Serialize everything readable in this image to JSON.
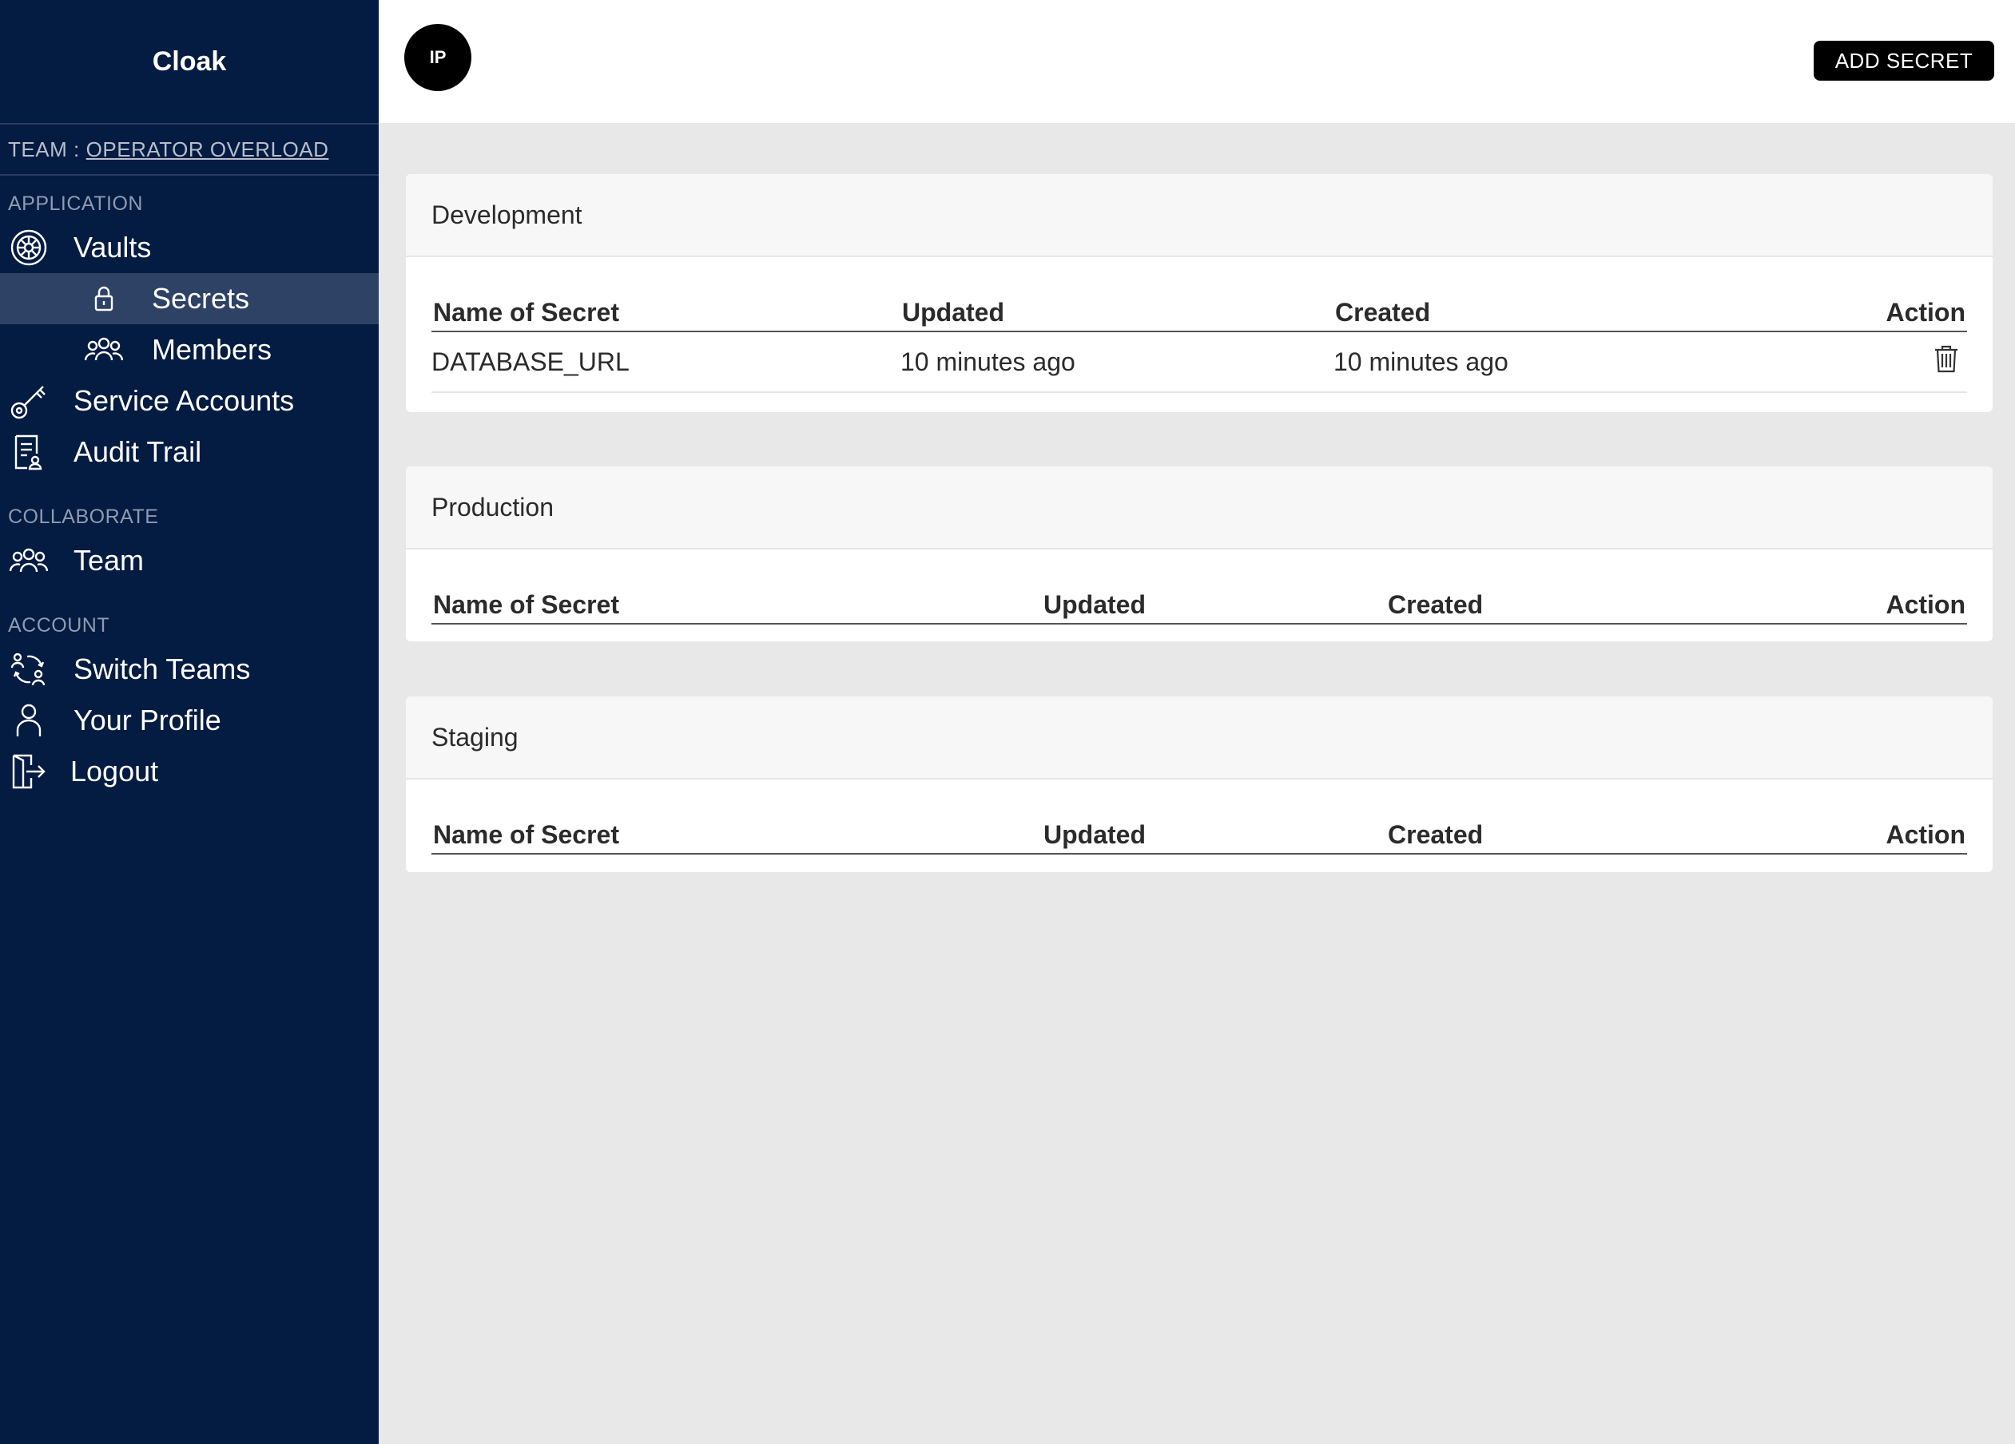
{
  "app": {
    "name": "Cloak"
  },
  "team": {
    "prefix": "TEAM :",
    "name": "OPERATOR OVERLOAD"
  },
  "sidebar": {
    "sections": {
      "application": "APPLICATION",
      "collaborate": "COLLABORATE",
      "account": "ACCOUNT"
    },
    "items": {
      "vaults": "Vaults",
      "secrets": "Secrets",
      "members": "Members",
      "service_accounts": "Service Accounts",
      "audit_trail": "Audit Trail",
      "team": "Team",
      "switch_teams": "Switch Teams",
      "your_profile": "Your Profile",
      "logout": "Logout"
    },
    "active_item": "Secrets"
  },
  "header": {
    "avatar_initials": "IP",
    "add_button": "ADD SECRET"
  },
  "environments": [
    {
      "name": "Development",
      "columns": [
        "Name of Secret",
        "Updated",
        "Created",
        "Action"
      ],
      "rows": [
        {
          "name": "DATABASE_URL",
          "updated": "10 minutes ago",
          "created": "10 minutes ago",
          "action_icon": "trash-icon"
        }
      ]
    },
    {
      "name": "Production",
      "columns": [
        "Name of Secret",
        "Updated",
        "Created",
        "Action"
      ],
      "rows": []
    },
    {
      "name": "Staging",
      "columns": [
        "Name of Secret",
        "Updated",
        "Created",
        "Action"
      ],
      "rows": []
    }
  ],
  "colors": {
    "sidebar_bg": "#041b42",
    "sidebar_active": "#2e4266",
    "button_bg": "#000000",
    "page_bg": "#e8e8e8"
  }
}
